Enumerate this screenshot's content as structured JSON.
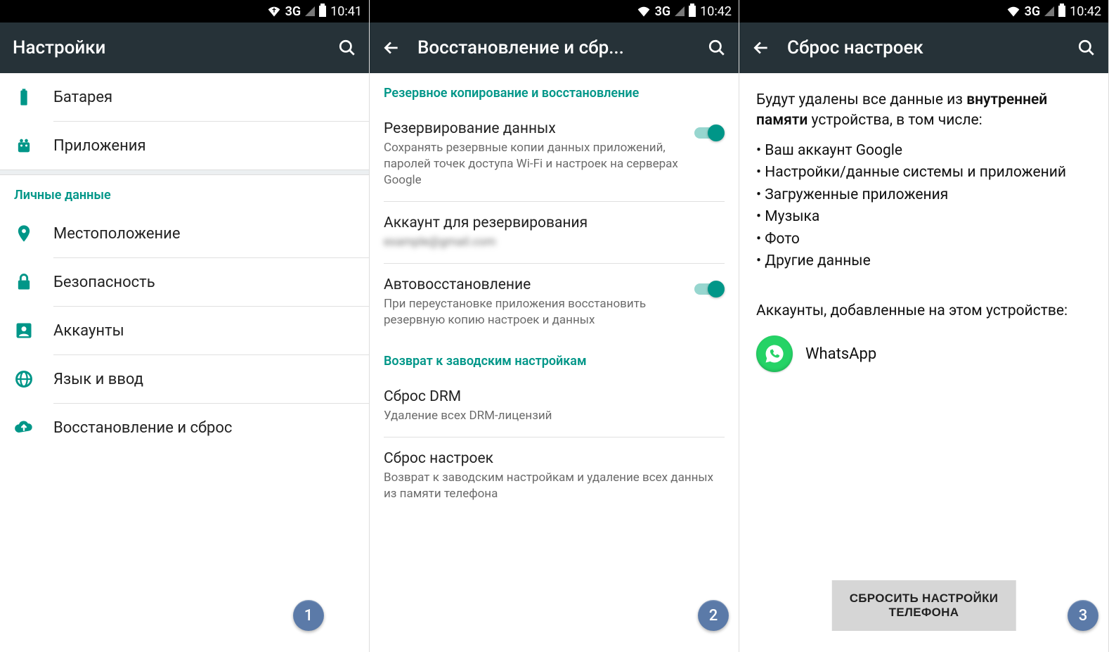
{
  "status": {
    "network": "3G",
    "time1": "10:41",
    "time2": "10:42",
    "time3": "10:42"
  },
  "screen1": {
    "title": "Настройки",
    "items": {
      "battery": "Батарея",
      "apps": "Приложения",
      "location": "Местоположение",
      "security": "Безопасность",
      "accounts": "Аккаунты",
      "language": "Язык и ввод",
      "backup": "Восстановление и сброс"
    },
    "section_personal": "Личные данные",
    "step": "1"
  },
  "screen2": {
    "title": "Восстановление и сбр...",
    "section1": "Резервное копирование и восстановление",
    "backup_data": {
      "title": "Резервирование данных",
      "sub": "Сохранять резервные копии данных приложений, паролей точек доступа Wi-Fi и настроек на серверах Google"
    },
    "backup_account": {
      "title": "Аккаунт для резервирования",
      "sub": "example@gmail.com"
    },
    "autorestore": {
      "title": "Автовосстановление",
      "sub": "При переустановке приложения восстановить резервную копию настроек и данных"
    },
    "section2": "Возврат к заводским настройкам",
    "drm": {
      "title": "Сброс DRM",
      "sub": "Удаление всех DRM-лицензий"
    },
    "factory": {
      "title": "Сброс настроек",
      "sub": "Возврат к заводским настройкам и удаление всех данных из памяти телефона"
    },
    "step": "2"
  },
  "screen3": {
    "title": "Сброс настроек",
    "intro_pre": "Будут удалены все данные из ",
    "intro_bold": "внутренней памяти",
    "intro_post": " устройства, в том числе:",
    "bullets": [
      "Ваш аккаунт Google",
      "Настройки/данные системы и приложений",
      "Загруженные приложения",
      "Музыка",
      "Фото",
      "Другие данные"
    ],
    "accounts_label": "Аккаунты, добавленные на этом устройстве:",
    "account_name": "WhatsApp",
    "button": "СБРОСИТЬ НАСТРОЙКИ ТЕЛЕФОНА",
    "step": "3"
  }
}
